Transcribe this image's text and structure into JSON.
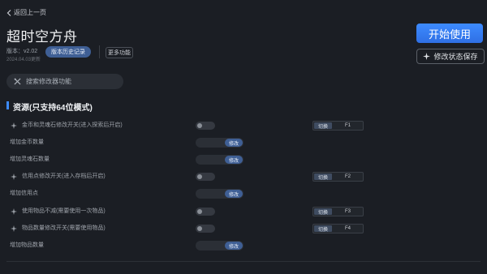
{
  "header": {
    "back_label": "返回上一页",
    "title": "超时空方舟",
    "version": "版本：v2.02",
    "date": "2024.04.03更新",
    "history_button": "版本历史记录",
    "more_button": "更多功能",
    "start_button": "开始使用",
    "save_button": "修改状态保存"
  },
  "search": {
    "placeholder": "搜索修改器功能"
  },
  "section": {
    "title": "资源(只支持64位模式)"
  },
  "rows": [
    {
      "label": "金币和灵魂石修改开关(进入探索后开启)",
      "type": "toggle",
      "switch_label": "切换",
      "hotkey": "F1"
    },
    {
      "label": "增加金币数量",
      "type": "modify",
      "modify_label": "修改"
    },
    {
      "label": "增加灵魂石数量",
      "type": "modify",
      "modify_label": "修改"
    },
    {
      "label": "信用点修改开关(进入存档后开启)",
      "type": "toggle",
      "switch_label": "切换",
      "hotkey": "F2"
    },
    {
      "label": "增加信用点",
      "type": "modify",
      "modify_label": "修改"
    },
    {
      "label": "使用物品不减(需要使用一次物品)",
      "type": "toggle",
      "switch_label": "切换",
      "hotkey": "F3"
    },
    {
      "label": "物品数量修改开关(需要使用物品)",
      "type": "toggle",
      "switch_label": "切换",
      "hotkey": "F4"
    },
    {
      "label": "增加物品数量",
      "type": "modify",
      "modify_label": "修改"
    }
  ],
  "colors": {
    "accent": "#3d8bff",
    "background": "#1b1e24",
    "button": "#3f5f95"
  }
}
